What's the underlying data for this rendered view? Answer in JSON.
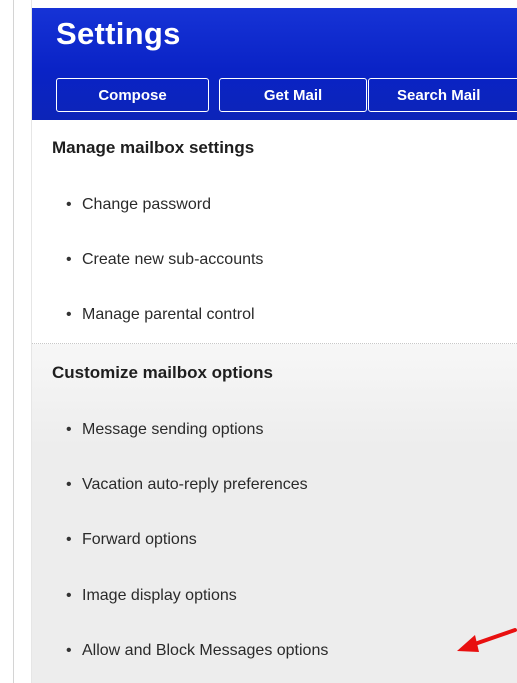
{
  "header": {
    "title": "Settings",
    "buttons": {
      "compose": "Compose",
      "get_mail": "Get Mail",
      "search_mail": "Search Mail"
    }
  },
  "sections": {
    "manage": {
      "title": "Manage mailbox settings",
      "items": [
        "Change password",
        "Create new sub-accounts",
        "Manage parental control"
      ]
    },
    "customize": {
      "title": "Customize mailbox options",
      "items": [
        "Message sending options",
        "Vacation auto-reply preferences",
        "Forward options",
        "Image display options",
        "Allow and Block Messages options"
      ]
    }
  },
  "colors": {
    "header_bg": "#0a23c6",
    "annotation_arrow": "#e81010"
  },
  "icons": {
    "bullet": "bullet-dot",
    "annotation": "red-arrow-icon"
  }
}
